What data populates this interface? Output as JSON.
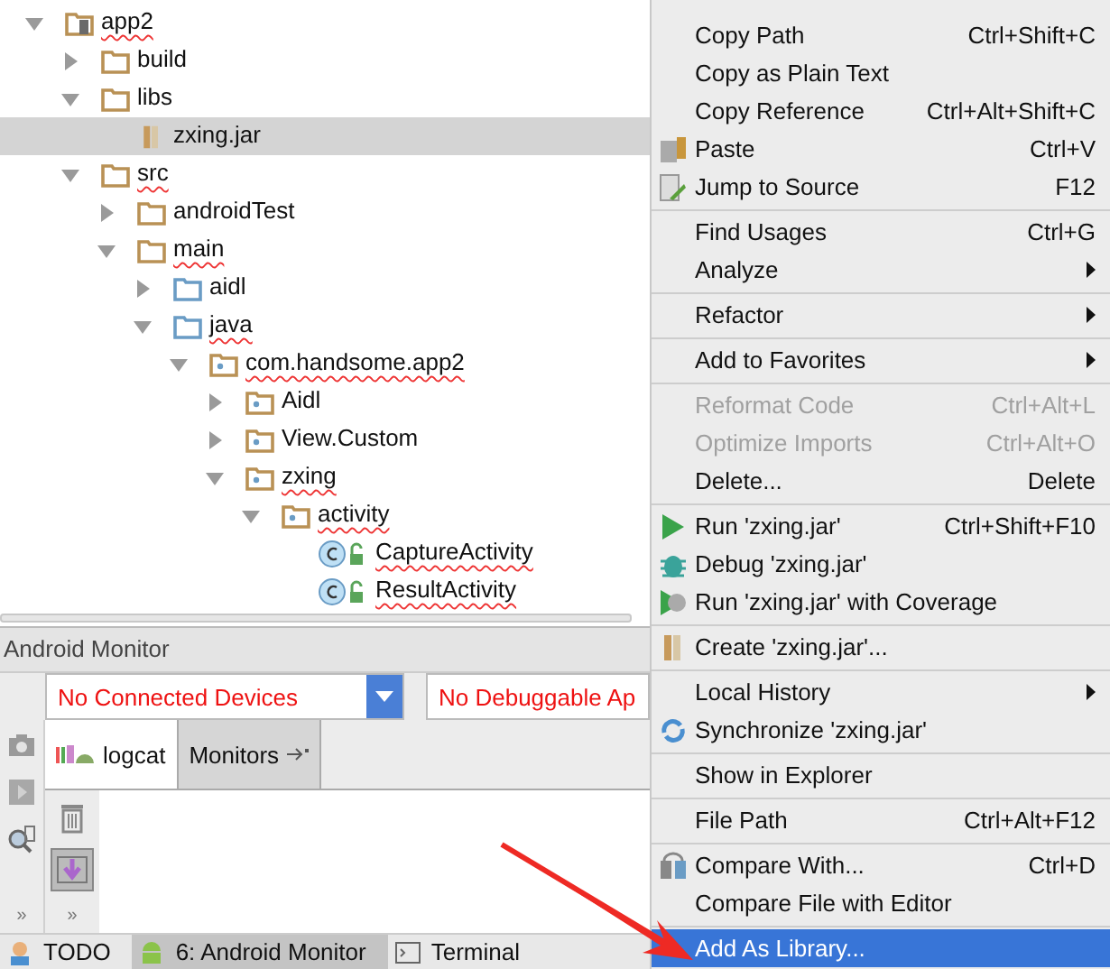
{
  "project_tree": [
    {
      "name": "app2",
      "kind": "module",
      "expanded": true,
      "selected": false,
      "misspelled": true,
      "children": [
        {
          "name": "build",
          "kind": "folder",
          "expanded": false,
          "selected": false,
          "misspelled": false
        },
        {
          "name": "libs",
          "kind": "folder",
          "expanded": true,
          "selected": false,
          "misspelled": false,
          "children": [
            {
              "name": "zxing.jar",
              "kind": "jar",
              "selected": true,
              "misspelled": false
            }
          ]
        },
        {
          "name": "src",
          "kind": "folder",
          "expanded": true,
          "selected": false,
          "misspelled": true,
          "children": [
            {
              "name": "androidTest",
              "kind": "folder",
              "expanded": false,
              "selected": false,
              "misspelled": false
            },
            {
              "name": "main",
              "kind": "folder",
              "expanded": true,
              "selected": false,
              "misspelled": true,
              "children": [
                {
                  "name": "aidl",
                  "kind": "source-folder",
                  "expanded": false,
                  "selected": false,
                  "misspelled": false
                },
                {
                  "name": "java",
                  "kind": "source-folder",
                  "expanded": true,
                  "selected": false,
                  "misspelled": true,
                  "children": [
                    {
                      "name": "com.handsome.app2",
                      "kind": "package",
                      "expanded": true,
                      "selected": false,
                      "misspelled": true,
                      "children": [
                        {
                          "name": "Aidl",
                          "kind": "package",
                          "expanded": false,
                          "selected": false,
                          "misspelled": false
                        },
                        {
                          "name": "View.Custom",
                          "kind": "package",
                          "expanded": false,
                          "selected": false,
                          "misspelled": false
                        },
                        {
                          "name": "zxing",
                          "kind": "package",
                          "expanded": true,
                          "selected": false,
                          "misspelled": true,
                          "children": [
                            {
                              "name": "activity",
                              "kind": "package",
                              "expanded": true,
                              "selected": false,
                              "misspelled": true,
                              "children": [
                                {
                                  "name": "CaptureActivity",
                                  "kind": "class",
                                  "selected": false,
                                  "misspelled": true
                                },
                                {
                                  "name": "ResultActivity",
                                  "kind": "class",
                                  "selected": false,
                                  "misspelled": true
                                }
                              ]
                            }
                          ]
                        }
                      ]
                    }
                  ]
                }
              ]
            }
          ]
        }
      ]
    }
  ],
  "android_monitor": {
    "title": "Android Monitor",
    "device_dropdown": "No Connected Devices",
    "app_dropdown": "No Debuggable Ap",
    "tabs": [
      {
        "label": "logcat",
        "selected": true
      },
      {
        "label": "Monitors",
        "selected": false
      }
    ],
    "more_left": "»",
    "more_right": "»"
  },
  "status_bar": [
    {
      "label": "TODO",
      "kind": "todo",
      "selected": false
    },
    {
      "label": "6: Android Monitor",
      "kind": "android",
      "selected": true
    },
    {
      "label": "Terminal",
      "kind": "terminal",
      "selected": false
    }
  ],
  "context_menu": [
    [
      {
        "label": "Copy Path",
        "shortcut": "Ctrl+Shift+C",
        "kind": "plain",
        "disabled": false,
        "submenu": false,
        "selected": false
      },
      {
        "label": "Copy as Plain Text",
        "kind": "plain",
        "disabled": false,
        "submenu": false,
        "selected": false
      },
      {
        "label": "Copy Reference",
        "shortcut": "Ctrl+Alt+Shift+C",
        "kind": "plain",
        "disabled": false,
        "submenu": false,
        "selected": false
      },
      {
        "label": "Paste",
        "shortcut": "Ctrl+V",
        "kind": "paste",
        "disabled": false,
        "submenu": false,
        "selected": false
      },
      {
        "label": "Jump to Source",
        "shortcut": "F12",
        "kind": "jump",
        "disabled": false,
        "submenu": false,
        "selected": false
      }
    ],
    [
      {
        "label": "Find Usages",
        "shortcut": "Ctrl+G",
        "kind": "plain",
        "disabled": false,
        "submenu": false,
        "selected": false
      },
      {
        "label": "Analyze",
        "kind": "plain",
        "disabled": false,
        "submenu": true,
        "selected": false
      }
    ],
    [
      {
        "label": "Refactor",
        "kind": "plain",
        "disabled": false,
        "submenu": true,
        "selected": false
      }
    ],
    [
      {
        "label": "Add to Favorites",
        "kind": "plain",
        "disabled": false,
        "submenu": true,
        "selected": false
      }
    ],
    [
      {
        "label": "Reformat Code",
        "shortcut": "Ctrl+Alt+L",
        "kind": "plain",
        "disabled": true,
        "submenu": false,
        "selected": false
      },
      {
        "label": "Optimize Imports",
        "shortcut": "Ctrl+Alt+O",
        "kind": "plain",
        "disabled": true,
        "submenu": false,
        "selected": false
      },
      {
        "label": "Delete...",
        "shortcut": "Delete",
        "kind": "plain",
        "disabled": false,
        "submenu": false,
        "selected": false
      }
    ],
    [
      {
        "label": "Run 'zxing.jar'",
        "shortcut": "Ctrl+Shift+F10",
        "kind": "run",
        "disabled": false,
        "submenu": false,
        "selected": false
      },
      {
        "label": "Debug 'zxing.jar'",
        "kind": "debug",
        "disabled": false,
        "submenu": false,
        "selected": false
      },
      {
        "label": "Run 'zxing.jar' with Coverage",
        "kind": "coverage",
        "disabled": false,
        "submenu": false,
        "selected": false
      }
    ],
    [
      {
        "label": "Create 'zxing.jar'...",
        "kind": "jar",
        "disabled": false,
        "submenu": false,
        "selected": false
      }
    ],
    [
      {
        "label": "Local History",
        "kind": "plain",
        "disabled": false,
        "submenu": true,
        "selected": false
      },
      {
        "label": "Synchronize 'zxing.jar'",
        "kind": "sync",
        "disabled": false,
        "submenu": false,
        "selected": false
      }
    ],
    [
      {
        "label": "Show in Explorer",
        "kind": "plain",
        "disabled": false,
        "submenu": false,
        "selected": false
      }
    ],
    [
      {
        "label": "File Path",
        "shortcut": "Ctrl+Alt+F12",
        "kind": "plain",
        "disabled": false,
        "submenu": false,
        "selected": false
      }
    ],
    [
      {
        "label": "Compare With...",
        "shortcut": "Ctrl+D",
        "kind": "compare",
        "disabled": false,
        "submenu": false,
        "selected": false
      },
      {
        "label": "Compare File with Editor",
        "kind": "plain",
        "disabled": false,
        "submenu": false,
        "selected": false
      }
    ],
    [
      {
        "label": "Add As Library...",
        "kind": "plain",
        "disabled": false,
        "submenu": false,
        "selected": true
      }
    ]
  ]
}
